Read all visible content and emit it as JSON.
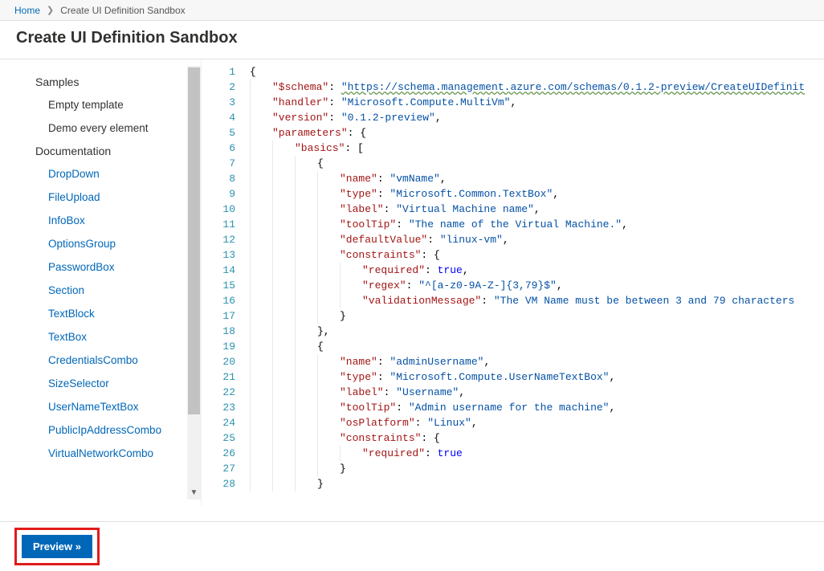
{
  "breadcrumb": {
    "home": "Home",
    "current": "Create UI Definition Sandbox"
  },
  "title": "Create UI Definition Sandbox",
  "sidebar": {
    "groups": [
      {
        "heading": "Samples",
        "items": [
          {
            "label": "Empty template",
            "link": false
          },
          {
            "label": "Demo every element",
            "link": false
          }
        ]
      },
      {
        "heading": "Documentation",
        "items": [
          {
            "label": "DropDown",
            "link": true
          },
          {
            "label": "FileUpload",
            "link": true
          },
          {
            "label": "InfoBox",
            "link": true
          },
          {
            "label": "OptionsGroup",
            "link": true
          },
          {
            "label": "PasswordBox",
            "link": true
          },
          {
            "label": "Section",
            "link": true
          },
          {
            "label": "TextBlock",
            "link": true
          },
          {
            "label": "TextBox",
            "link": true
          },
          {
            "label": "CredentialsCombo",
            "link": true
          },
          {
            "label": "SizeSelector",
            "link": true
          },
          {
            "label": "UserNameTextBox",
            "link": true
          },
          {
            "label": "PublicIpAddressCombo",
            "link": true
          },
          {
            "label": "VirtualNetworkCombo",
            "link": true
          }
        ]
      }
    ]
  },
  "editor": {
    "first_line": 1,
    "last_line": 28,
    "lines": [
      [
        [
          "punc",
          "{"
        ]
      ],
      [
        [
          "ind",
          1
        ],
        [
          "key",
          "\"$schema\""
        ],
        [
          "punc",
          ": "
        ],
        [
          "url",
          "\"https://schema.management.azure.com/schemas/0.1.2-preview/CreateUIDefinit"
        ]
      ],
      [
        [
          "ind",
          1
        ],
        [
          "key",
          "\"handler\""
        ],
        [
          "punc",
          ": "
        ],
        [
          "str",
          "\"Microsoft.Compute.MultiVm\""
        ],
        [
          "punc",
          ","
        ]
      ],
      [
        [
          "ind",
          1
        ],
        [
          "key",
          "\"version\""
        ],
        [
          "punc",
          ": "
        ],
        [
          "str",
          "\"0.1.2-preview\""
        ],
        [
          "punc",
          ","
        ]
      ],
      [
        [
          "ind",
          1
        ],
        [
          "key",
          "\"parameters\""
        ],
        [
          "punc",
          ": {"
        ]
      ],
      [
        [
          "ind",
          2
        ],
        [
          "key",
          "\"basics\""
        ],
        [
          "punc",
          ": ["
        ]
      ],
      [
        [
          "ind",
          3
        ],
        [
          "punc",
          "{"
        ]
      ],
      [
        [
          "ind",
          4
        ],
        [
          "key",
          "\"name\""
        ],
        [
          "punc",
          ": "
        ],
        [
          "str",
          "\"vmName\""
        ],
        [
          "punc",
          ","
        ]
      ],
      [
        [
          "ind",
          4
        ],
        [
          "key",
          "\"type\""
        ],
        [
          "punc",
          ": "
        ],
        [
          "str",
          "\"Microsoft.Common.TextBox\""
        ],
        [
          "punc",
          ","
        ]
      ],
      [
        [
          "ind",
          4
        ],
        [
          "key",
          "\"label\""
        ],
        [
          "punc",
          ": "
        ],
        [
          "str",
          "\"Virtual Machine name\""
        ],
        [
          "punc",
          ","
        ]
      ],
      [
        [
          "ind",
          4
        ],
        [
          "key",
          "\"toolTip\""
        ],
        [
          "punc",
          ": "
        ],
        [
          "str",
          "\"The name of the Virtual Machine.\""
        ],
        [
          "punc",
          ","
        ]
      ],
      [
        [
          "ind",
          4
        ],
        [
          "key",
          "\"defaultValue\""
        ],
        [
          "punc",
          ": "
        ],
        [
          "str",
          "\"linux-vm\""
        ],
        [
          "punc",
          ","
        ]
      ],
      [
        [
          "ind",
          4
        ],
        [
          "key",
          "\"constraints\""
        ],
        [
          "punc",
          ": {"
        ]
      ],
      [
        [
          "ind",
          5
        ],
        [
          "key",
          "\"required\""
        ],
        [
          "punc",
          ": "
        ],
        [
          "kw",
          "true"
        ],
        [
          "punc",
          ","
        ]
      ],
      [
        [
          "ind",
          5
        ],
        [
          "key",
          "\"regex\""
        ],
        [
          "punc",
          ": "
        ],
        [
          "str",
          "\"^[a-z0-9A-Z-]{3,79}$\""
        ],
        [
          "punc",
          ","
        ]
      ],
      [
        [
          "ind",
          5
        ],
        [
          "key",
          "\"validationMessage\""
        ],
        [
          "punc",
          ": "
        ],
        [
          "str",
          "\"The VM Name must be between 3 and 79 characters"
        ]
      ],
      [
        [
          "ind",
          4
        ],
        [
          "punc",
          "}"
        ]
      ],
      [
        [
          "ind",
          3
        ],
        [
          "punc",
          "},"
        ]
      ],
      [
        [
          "ind",
          3
        ],
        [
          "punc",
          "{"
        ]
      ],
      [
        [
          "ind",
          4
        ],
        [
          "key",
          "\"name\""
        ],
        [
          "punc",
          ": "
        ],
        [
          "str",
          "\"adminUsername\""
        ],
        [
          "punc",
          ","
        ]
      ],
      [
        [
          "ind",
          4
        ],
        [
          "key",
          "\"type\""
        ],
        [
          "punc",
          ": "
        ],
        [
          "str",
          "\"Microsoft.Compute.UserNameTextBox\""
        ],
        [
          "punc",
          ","
        ]
      ],
      [
        [
          "ind",
          4
        ],
        [
          "key",
          "\"label\""
        ],
        [
          "punc",
          ": "
        ],
        [
          "str",
          "\"Username\""
        ],
        [
          "punc",
          ","
        ]
      ],
      [
        [
          "ind",
          4
        ],
        [
          "key",
          "\"toolTip\""
        ],
        [
          "punc",
          ": "
        ],
        [
          "str",
          "\"Admin username for the machine\""
        ],
        [
          "punc",
          ","
        ]
      ],
      [
        [
          "ind",
          4
        ],
        [
          "key",
          "\"osPlatform\""
        ],
        [
          "punc",
          ": "
        ],
        [
          "str",
          "\"Linux\""
        ],
        [
          "punc",
          ","
        ]
      ],
      [
        [
          "ind",
          4
        ],
        [
          "key",
          "\"constraints\""
        ],
        [
          "punc",
          ": {"
        ]
      ],
      [
        [
          "ind",
          5
        ],
        [
          "key",
          "\"required\""
        ],
        [
          "punc",
          ": "
        ],
        [
          "kw",
          "true"
        ]
      ],
      [
        [
          "ind",
          4
        ],
        [
          "punc",
          "}"
        ]
      ],
      [
        [
          "ind",
          3
        ],
        [
          "punc",
          "}"
        ]
      ]
    ]
  },
  "footer": {
    "preview_label": "Preview »"
  }
}
